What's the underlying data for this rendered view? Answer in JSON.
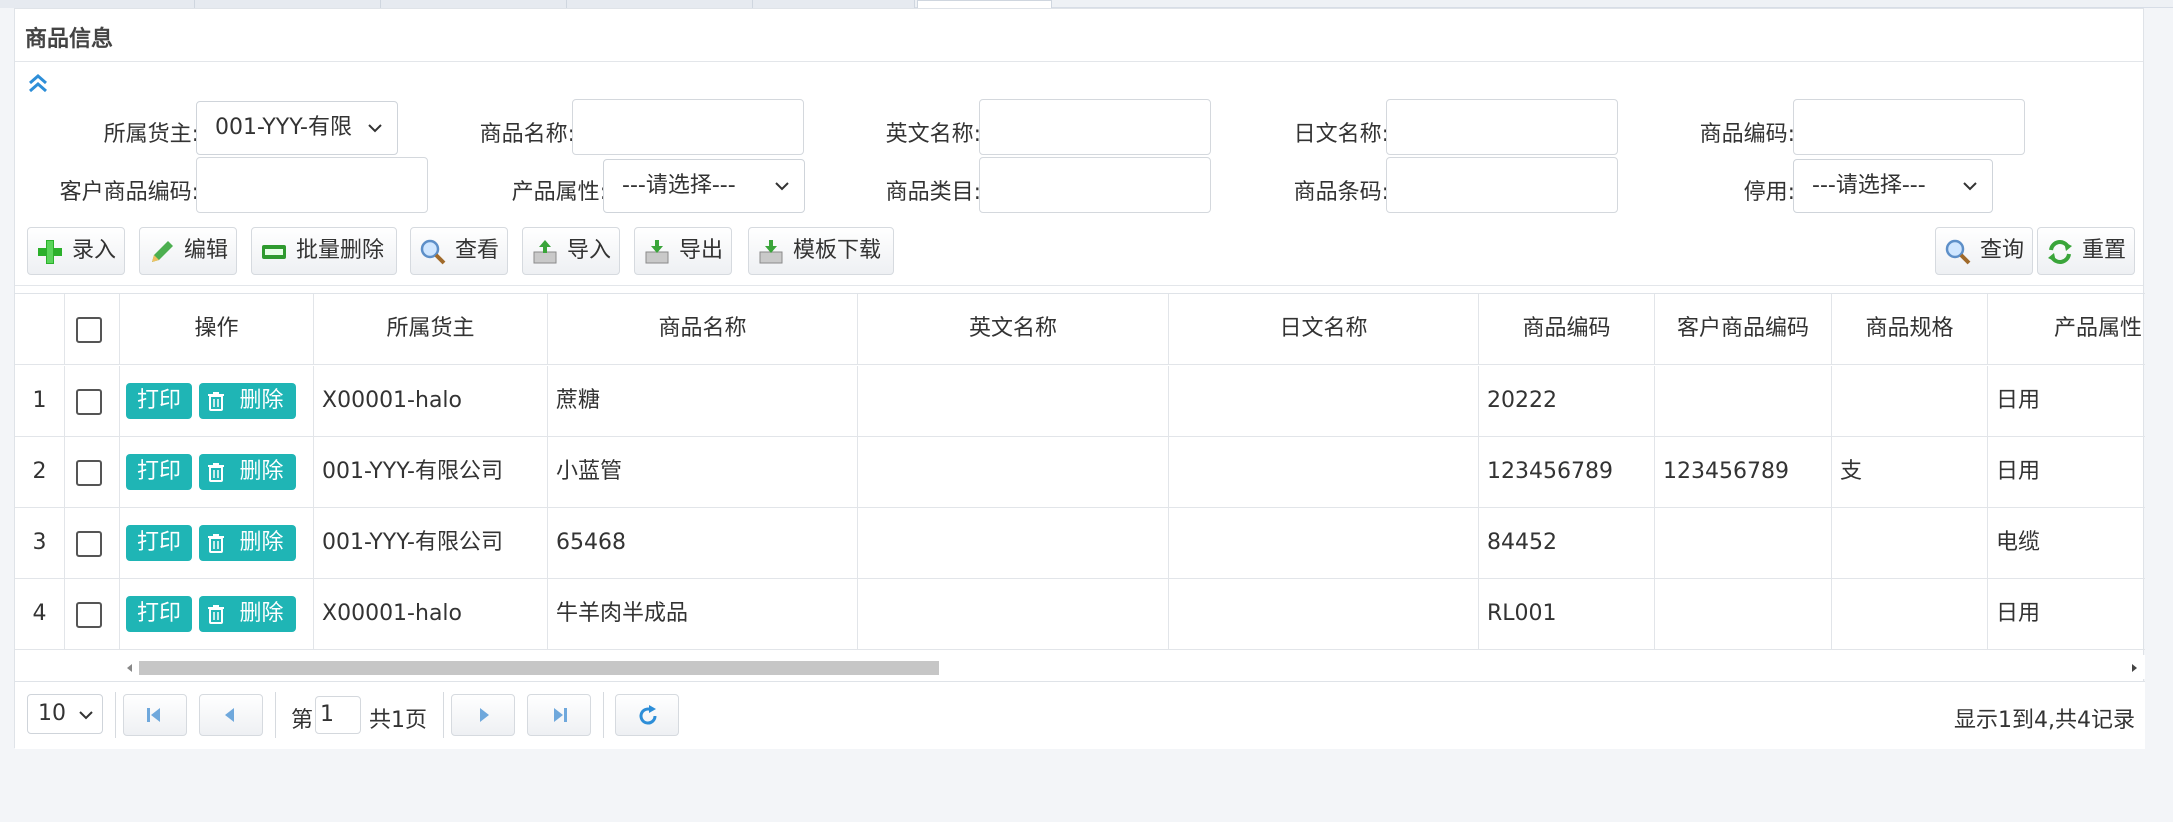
{
  "panel": {
    "title": "商品信息"
  },
  "filters": {
    "owner": {
      "label": "所属货主:",
      "value": "001-YYY-有限"
    },
    "product_name": {
      "label": "商品名称:",
      "value": ""
    },
    "english_name": {
      "label": "英文名称:",
      "value": ""
    },
    "japanese_name": {
      "label": "日文名称:",
      "value": ""
    },
    "product_code": {
      "label": "商品编码:",
      "value": ""
    },
    "customer_code": {
      "label": "客户商品编码:",
      "value": ""
    },
    "attribute": {
      "label": "产品属性:",
      "value": "---请选择---"
    },
    "category": {
      "label": "商品类目:",
      "value": ""
    },
    "barcode": {
      "label": "商品条码:",
      "value": ""
    },
    "disabled": {
      "label": "停用:",
      "value": "---请选择---"
    }
  },
  "toolbar": {
    "add": "录入",
    "edit": "编辑",
    "batch_delete": "批量删除",
    "view": "查看",
    "import": "导入",
    "export": "导出",
    "template": "模板下载",
    "search": "查询",
    "reset": "重置"
  },
  "table": {
    "headers": [
      "操作",
      "所属货主",
      "商品名称",
      "英文名称",
      "日文名称",
      "商品编码",
      "客户商品编码",
      "商品规格",
      "产品属性"
    ],
    "actions": {
      "print": "打印",
      "delete": "删除"
    },
    "rows": [
      {
        "num": "1",
        "owner": "X00001-halo",
        "name": "蔗糖",
        "en": "",
        "jp": "",
        "code": "20222",
        "cust": "",
        "spec": "",
        "attr": "日用"
      },
      {
        "num": "2",
        "owner": "001-YYY-有限公司",
        "name": "小蓝管",
        "en": "",
        "jp": "",
        "code": "123456789",
        "cust": "123456789",
        "spec": "支",
        "attr": "日用"
      },
      {
        "num": "3",
        "owner": "001-YYY-有限公司",
        "name": "65468",
        "en": "",
        "jp": "",
        "code": "84452",
        "cust": "",
        "spec": "",
        "attr": "电缆"
      },
      {
        "num": "4",
        "owner": "X00001-halo",
        "name": "牛羊肉半成品",
        "en": "",
        "jp": "",
        "code": "RL001",
        "cust": "",
        "spec": "",
        "attr": "日用"
      }
    ]
  },
  "pager": {
    "page_size": "10",
    "page_prefix": "第",
    "page_value": "1",
    "page_total": "共1页",
    "summary": "显示1到4,共4记录"
  },
  "colors": {
    "accent": "#1fb5b5",
    "link": "#2d8ed8"
  }
}
